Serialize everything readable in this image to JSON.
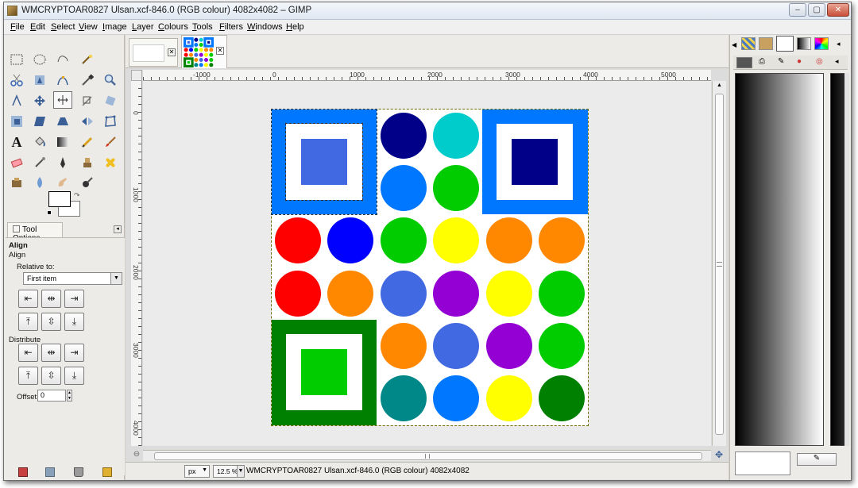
{
  "window": {
    "title": "WMCRYPTOAR0827 Ulsan.xcf-846.0 (RGB colour) 4082x4082 – GIMP",
    "minimize_label": "–",
    "maximize_label": "▢",
    "close_label": "✕"
  },
  "menu": [
    {
      "key": "F",
      "rest": "ile"
    },
    {
      "key": "E",
      "rest": "dit"
    },
    {
      "key": "S",
      "rest": "elect"
    },
    {
      "key": "V",
      "rest": "iew"
    },
    {
      "key": "I",
      "rest": "mage"
    },
    {
      "key": "L",
      "rest": "ayer"
    },
    {
      "key": "C",
      "rest": "olours"
    },
    {
      "key": "T",
      "rest": "ools"
    },
    {
      "key": "F",
      "rest": "ilters"
    },
    {
      "key": "W",
      "rest": "indows"
    },
    {
      "key": "H",
      "rest": "elp"
    }
  ],
  "tool_options": {
    "tab_label": "Tool Options",
    "heading": "Align",
    "subheading": "Align",
    "relative_label": "Relative to:",
    "relative_value": "First item",
    "distribute_label": "Distribute",
    "offset_label": "Offset:",
    "offset_value": "0"
  },
  "rulers": {
    "h_ticks": [
      "-1000",
      "0",
      "1000",
      "2000",
      "3000",
      "4000",
      "5000"
    ],
    "v_ticks": [
      "0",
      "1000",
      "2000",
      "3000",
      "4000"
    ]
  },
  "status": {
    "unit": "px",
    "zoom": "12.5 %",
    "message": "WMCRYPTOAR0827 Ulsan.xcf-846.0 (RGB colour) 4082x4082"
  },
  "canvas": {
    "colors": {
      "red": "#ff0000",
      "blue": "#0000ff",
      "green": "#00cc00",
      "yellow": "#ffff00",
      "orange": "#ff8800",
      "navy": "#000088",
      "cyan": "#00cccc",
      "azure": "#0077ff",
      "royal": "#4169e1",
      "purple": "#9400d3",
      "teal": "#008888",
      "darkgreen": "#008000"
    }
  }
}
